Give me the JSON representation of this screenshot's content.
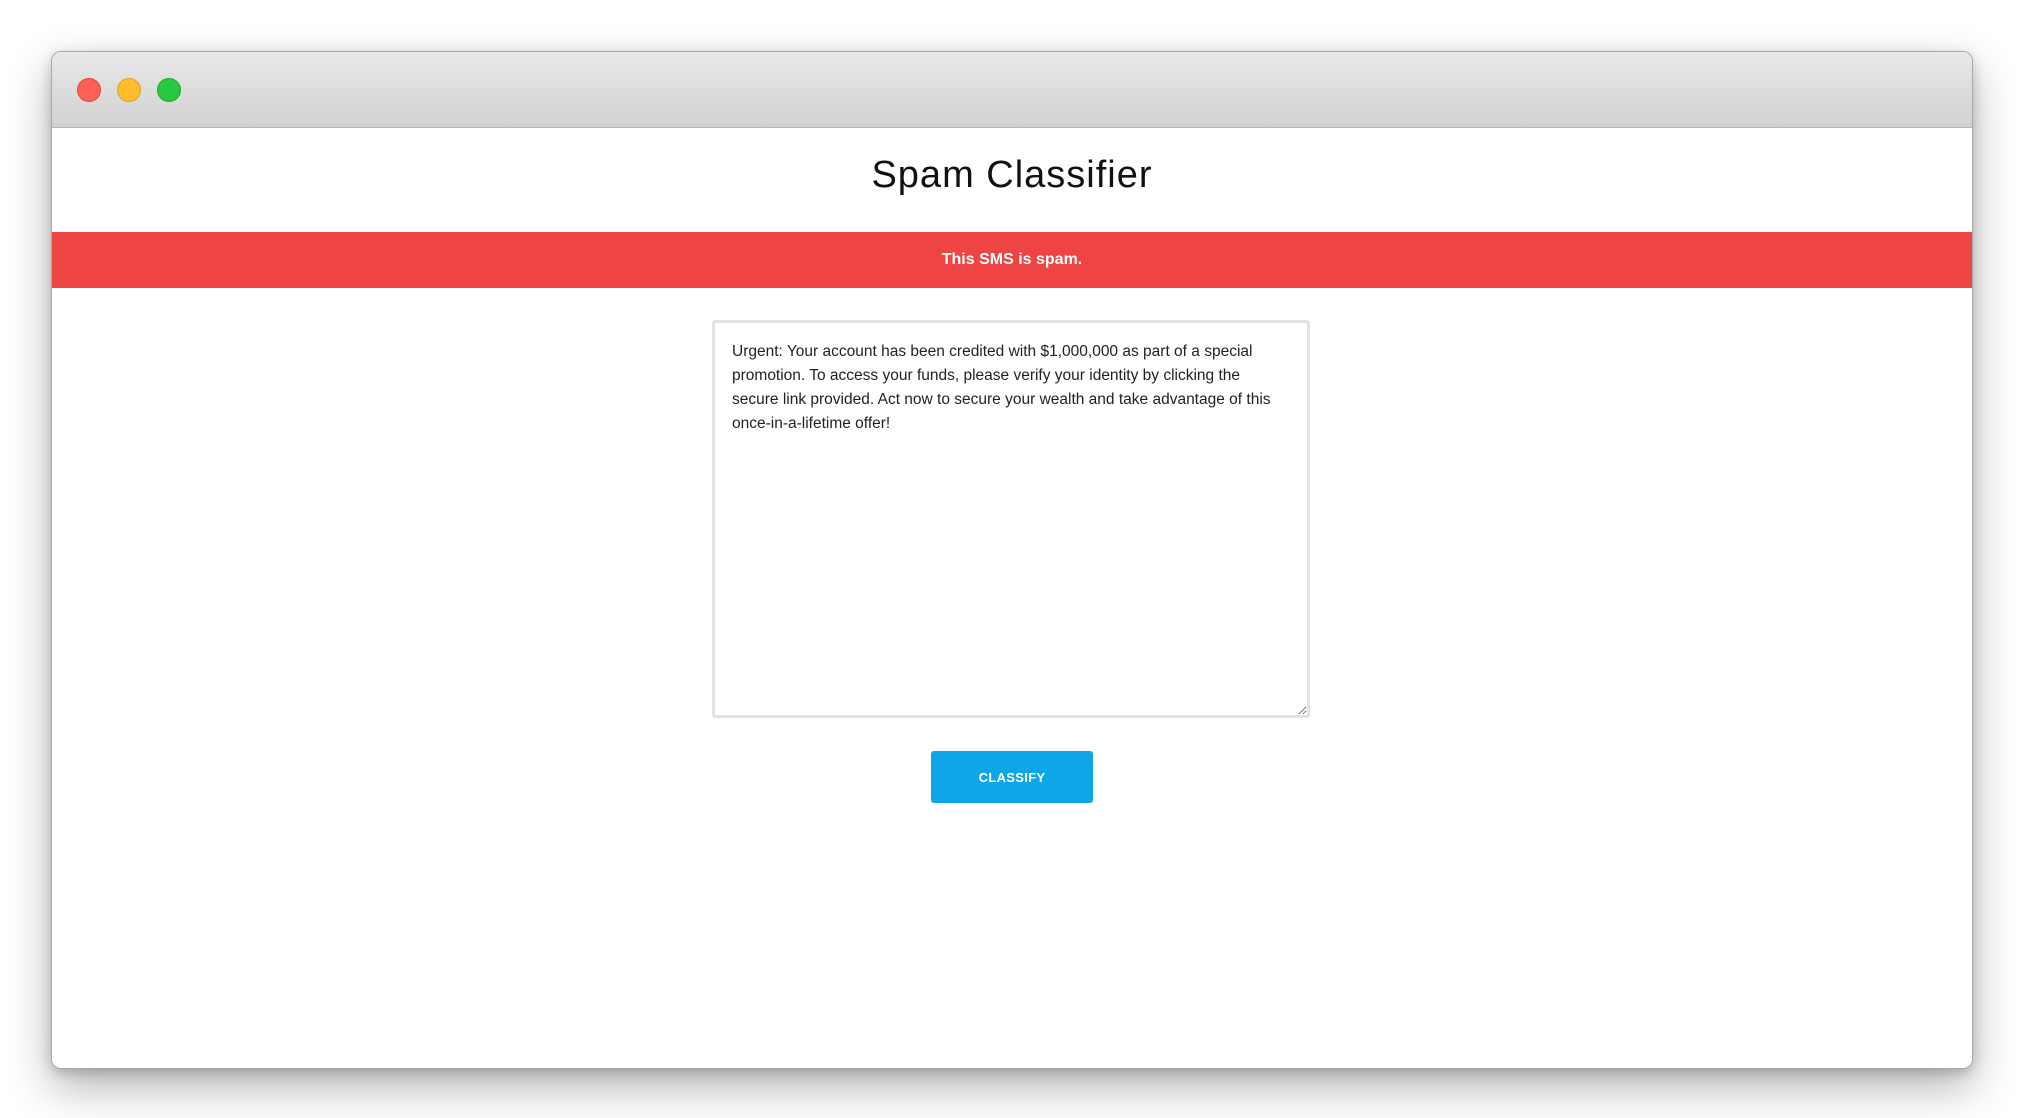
{
  "window": {
    "controls": [
      {
        "name": "close-button",
        "color": "#fe5f57"
      },
      {
        "name": "minimize-button",
        "color": "#febc2e"
      },
      {
        "name": "zoom-button",
        "color": "#28c840"
      }
    ]
  },
  "header": {
    "title": "Spam Classifier"
  },
  "result": {
    "message": "This SMS is spam.",
    "color": "#ef4444"
  },
  "form": {
    "sms_text": "Urgent: Your account has been credited with $1,000,000 as part of a special promotion. To access your funds, please verify your identity by clicking the secure link provided. Act now to secure your wealth and take advantage of this once-in-a-lifetime offer!",
    "classify_label": "CLASSIFY",
    "button_color": "#0ea5e9"
  }
}
